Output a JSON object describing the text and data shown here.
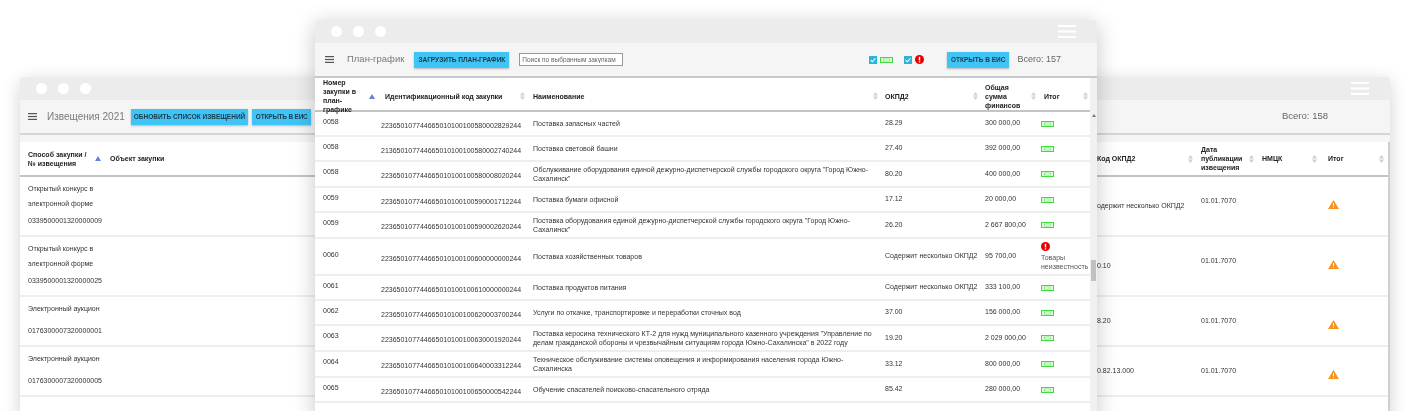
{
  "back_window": {
    "title": "Извещения 2021",
    "buttons": [
      "ОБНОВИТЬ СПИСОК ИЗВЕЩЕНИЙ",
      "ОТКРЫТЬ В ЕИС"
    ],
    "total": "Всего: 158",
    "columns": [
      {
        "label": "Способ закупки / № извещения",
        "sorted": true
      },
      {
        "label": "Объект закупки"
      },
      {
        "label": "Код ОКПД2",
        "sorted": false
      },
      {
        "label": "Дата публикации извещения",
        "sorted": false
      },
      {
        "label": "НМЦК",
        "sorted": false
      },
      {
        "label": "Итог",
        "sorted": false
      }
    ],
    "rows": [
      {
        "method": "Открытый конкурс в электронной форме",
        "number": "0339500001320000009",
        "okpd": "одержит несколько ОКПД2",
        "date": "01.01.7070",
        "kind": "warning"
      },
      {
        "method": "Открытый конкурс в электронной форме",
        "number": "0339500001320000025",
        "okpd": "0.10",
        "date": "01.01.7070",
        "kind": "warning"
      },
      {
        "method": "Электронный аукцион",
        "number": "0176300007320000001",
        "okpd": "8.20",
        "date": "01.01.7070",
        "kind": "warning"
      },
      {
        "method": "Электронный аукцион",
        "number": "0176300007320000005",
        "okpd": "0.82.13.000",
        "date": "01.01.7070",
        "kind": "warning"
      }
    ]
  },
  "front_window": {
    "title": "План-график",
    "upload_button": "ЗАГРУЗИТЬ ПЛАН-ГРАФИК",
    "search": {
      "placeholder": "Поиск по выбранным закупкам"
    },
    "filters": [
      {
        "kind": "ok",
        "checked": true
      },
      {
        "kind": "error",
        "checked": true
      }
    ],
    "open_button": "ОТКРЫТЬ В ЕИС",
    "total": "Всего: 157",
    "columns": [
      {
        "label": "Номер закупки в план-графике",
        "sorted": true
      },
      {
        "label": "Идентификационный код закупки",
        "sorted": false
      },
      {
        "label": "Наименование",
        "sorted": false
      },
      {
        "label": "ОКПД2",
        "sorted": false
      },
      {
        "label": "Общая сумма финансов",
        "sorted": false
      },
      {
        "label": "Итог",
        "sorted": false
      }
    ],
    "rows": [
      {
        "number": "0058",
        "code": "223650107744665010100100580002829244",
        "name": "Поставка запасных частей",
        "okpd": "28.29",
        "sum": "300 000,00",
        "kind": "ok"
      },
      {
        "number": "0058",
        "code": "213650107744665010100100580002740244",
        "name": "Поставка световой башни",
        "okpd": "27.40",
        "sum": "392 000,00",
        "kind": "ok"
      },
      {
        "number": "0058",
        "code": "223650107744665010100100580008020244",
        "name": "Обслуживание оборудования единой дежурно-диспетчерской службы городского округа \"Город Южно-Сахалинск\"",
        "okpd": "80.20",
        "sum": "400 000,00",
        "kind": "ok"
      },
      {
        "number": "0059",
        "code": "223650107744665010100100590001712244",
        "name": "Поставка бумаги офисной",
        "okpd": "17.12",
        "sum": "20 000,00",
        "kind": "ok"
      },
      {
        "number": "0059",
        "code": "223650107744665010100100590002620244",
        "name": "Поставка оборудования единой дежурно-диспетчерской службы городского округа \"Город Южно-Сахалинск\"",
        "okpd": "26.20",
        "sum": "2 667 800,00",
        "kind": "ok"
      },
      {
        "number": "0060",
        "code": "223650107744665010100100600000000244",
        "name": "Поставка хозяйственных товаров",
        "okpd": "Содержит несколько ОКПД2",
        "sum": "95 700,00",
        "kind": "error",
        "note": "Товары неизвестность"
      },
      {
        "number": "0061",
        "code": "223650107744665010100100610000000244",
        "name": "Поставка продуктов питания",
        "okpd": "Содержит несколько ОКПД2",
        "sum": "333 100,00",
        "kind": "ok"
      },
      {
        "number": "0062",
        "code": "223650107744665010100100620003700244",
        "name": "Услуги по откачке, транспортировке и переработки сточных вод",
        "okpd": "37.00",
        "sum": "156 000,00",
        "kind": "ok"
      },
      {
        "number": "0063",
        "code": "223650107744665010100100630001920244",
        "name": "Поставка керосина технического КТ-2 для нужд муниципального казенного учреждения \"Управление по делам гражданской обороны и чрезвычайным ситуациям города Южно-Сахалинска\" в 2022 году",
        "okpd": "19.20",
        "sum": "2 029 000,00",
        "kind": "ok"
      },
      {
        "number": "0064",
        "code": "223650107744665010100100640003312244",
        "name": "Техническое обслуживание системы оповещения и информирования населения города Южно-Сахалинска",
        "okpd": "33.12",
        "sum": "800 000,00",
        "kind": "ok"
      },
      {
        "number": "0065",
        "code": "223650107744665010100100650000542244",
        "name": "Обучение спасателей поисково-спасательного отряда",
        "okpd": "85.42",
        "sum": "280 000,00",
        "kind": "ok"
      }
    ]
  }
}
